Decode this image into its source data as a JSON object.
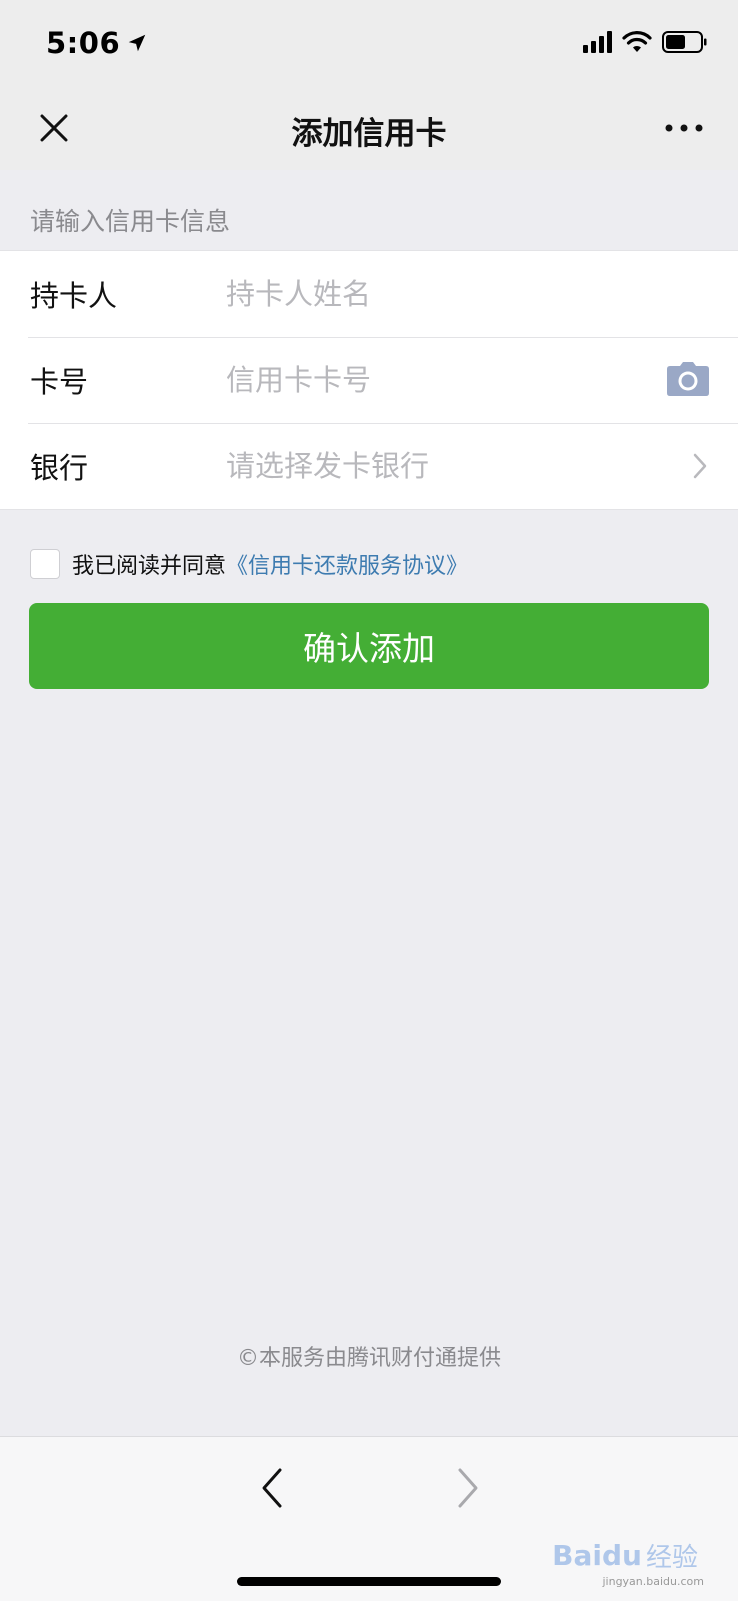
{
  "status_bar": {
    "time": "5:06"
  },
  "nav": {
    "title": "添加信用卡"
  },
  "form": {
    "section_hint": "请输入信用卡信息",
    "rows": [
      {
        "label": "持卡人",
        "placeholder": "持卡人姓名",
        "value": ""
      },
      {
        "label": "卡号",
        "placeholder": "信用卡卡号",
        "value": ""
      },
      {
        "label": "银行",
        "placeholder": "请选择发卡银行",
        "value": ""
      }
    ]
  },
  "agreement": {
    "text": "我已阅读并同意",
    "link_text": "《信用卡还款服务协议》",
    "checked": false
  },
  "confirm_button": {
    "label": "确认添加",
    "color": "#44ae35"
  },
  "footer": {
    "note": "©本服务由腾讯财付通提供"
  },
  "watermark": {
    "logo": "Baidu",
    "sub": "经验",
    "url": "jingyan.baidu.com"
  },
  "colors": {
    "link": "#3d7bb0",
    "background": "#ededf1"
  }
}
